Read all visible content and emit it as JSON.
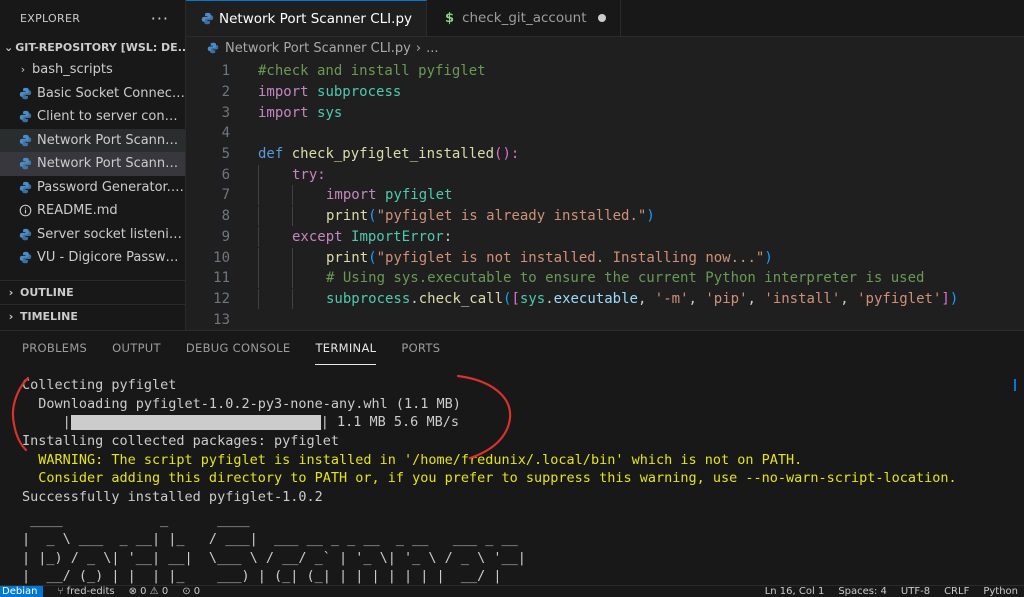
{
  "sidebar": {
    "title": "EXPLORER",
    "more_icon": "ellipsis-icon",
    "root_label": "GIT-REPOSITORY [WSL: DE...",
    "items": [
      {
        "label": "bash_scripts",
        "kind": "folder"
      },
      {
        "label": "Basic Socket Connecti...",
        "kind": "python"
      },
      {
        "label": "Client to server conne...",
        "kind": "python"
      },
      {
        "label": "Network Port Scanner...",
        "kind": "python"
      },
      {
        "label": "Network Port Scanner...",
        "kind": "python"
      },
      {
        "label": "Password Generator.py",
        "kind": "python"
      },
      {
        "label": "README.md",
        "kind": "info"
      },
      {
        "label": "Server socket listenin...",
        "kind": "python"
      },
      {
        "label": "VU - Digicore Passwo...",
        "kind": "python"
      }
    ],
    "outline": "OUTLINE",
    "timeline": "TIMELINE"
  },
  "tabs": [
    {
      "label": "Network Port Scanner CLI.py",
      "icon": "python-icon",
      "active": true
    },
    {
      "label": "check_git_account",
      "icon": "shell-dollar-icon",
      "active": false,
      "modified": true
    }
  ],
  "breadcrumb": {
    "file": "Network Port Scanner CLI.py",
    "sep": "›",
    "more": "..."
  },
  "code": {
    "line_numbers": [
      "1",
      "2",
      "3",
      "4",
      "5",
      "6",
      "7",
      "8",
      "9",
      "10",
      "11",
      "12",
      "13"
    ],
    "l1": "#check and install pyfiglet",
    "l2_kw": "import",
    "l2_mod": "subprocess",
    "l3_kw": "import",
    "l3_mod": "sys",
    "l5_kw": "def",
    "l5_fn": "check_pyfiglet_installed",
    "l5_tail": "():",
    "l6_kw": "try:",
    "l7_kw": "import",
    "l7_mod": "pyfiglet",
    "l8_fn": "print",
    "l8_str": "\"pyfiglet is already installed.\"",
    "l9_kw": "except",
    "l9_cls": "ImportError",
    "l9_tail": ":",
    "l10_fn": "print",
    "l10_str": "\"pyfiglet is not installed. Installing now...\"",
    "l11": "# Using sys.executable to ensure the current Python interpreter is used",
    "l12_obj": "subprocess",
    "l12_fn": "check_call",
    "l12_mod": "sys",
    "l12_attr": "executable",
    "l12_a1": "'-m'",
    "l12_a2": "'pip'",
    "l12_a3": "'install'",
    "l12_a4": "'pyfiglet'"
  },
  "panel": {
    "tabs": [
      "PROBLEMS",
      "OUTPUT",
      "DEBUG CONSOLE",
      "TERMINAL",
      "PORTS"
    ],
    "active_tab": "TERMINAL"
  },
  "terminal": {
    "lines": [
      "Collecting pyfiglet",
      "  Downloading pyfiglet-1.0.2-py3-none-any.whl (1.1 MB)",
      "     |",
      "Installing collected packages: pyfiglet",
      "  WARNING: The script pyfiglet is installed in '/home/fredunix/.local/bin' which is not on PATH.",
      "  Consider adding this directory to PATH or, if you prefer to suppress this warning, use --no-warn-script-location.",
      "Successfully installed pyfiglet-1.0.2"
    ],
    "progress_tail": "| 1.1 MB 5.6 MB/s",
    "progress_fraction": 1.0,
    "ascii_art": [
      " ____            _      ____",
      "|  _ \\ ___  _ __| |_   / ___|  ___ __ _ _ __  _ __   ___ _ __",
      "| |_) / _ \\| '__| __|  \\___ \\ / __/ _` | '_ \\| '_ \\ / _ \\ '__|",
      "|  __/ (_) | |  | |_    ___) | (_| (_| | | | | | | |  __/ |"
    ]
  },
  "status": {
    "remote": "Debian",
    "branch": "fred-edits",
    "problems": "⊗ 0 ⚠ 0",
    "ports": "0",
    "cursor": "Ln 16, Col 1",
    "spaces": "Spaces: 4",
    "encoding": "UTF-8",
    "eol": "CRLF",
    "language": "Python"
  },
  "colors": {
    "accent": "#0078d4",
    "annotation": "#d9312b",
    "warning": "#e5e510"
  }
}
